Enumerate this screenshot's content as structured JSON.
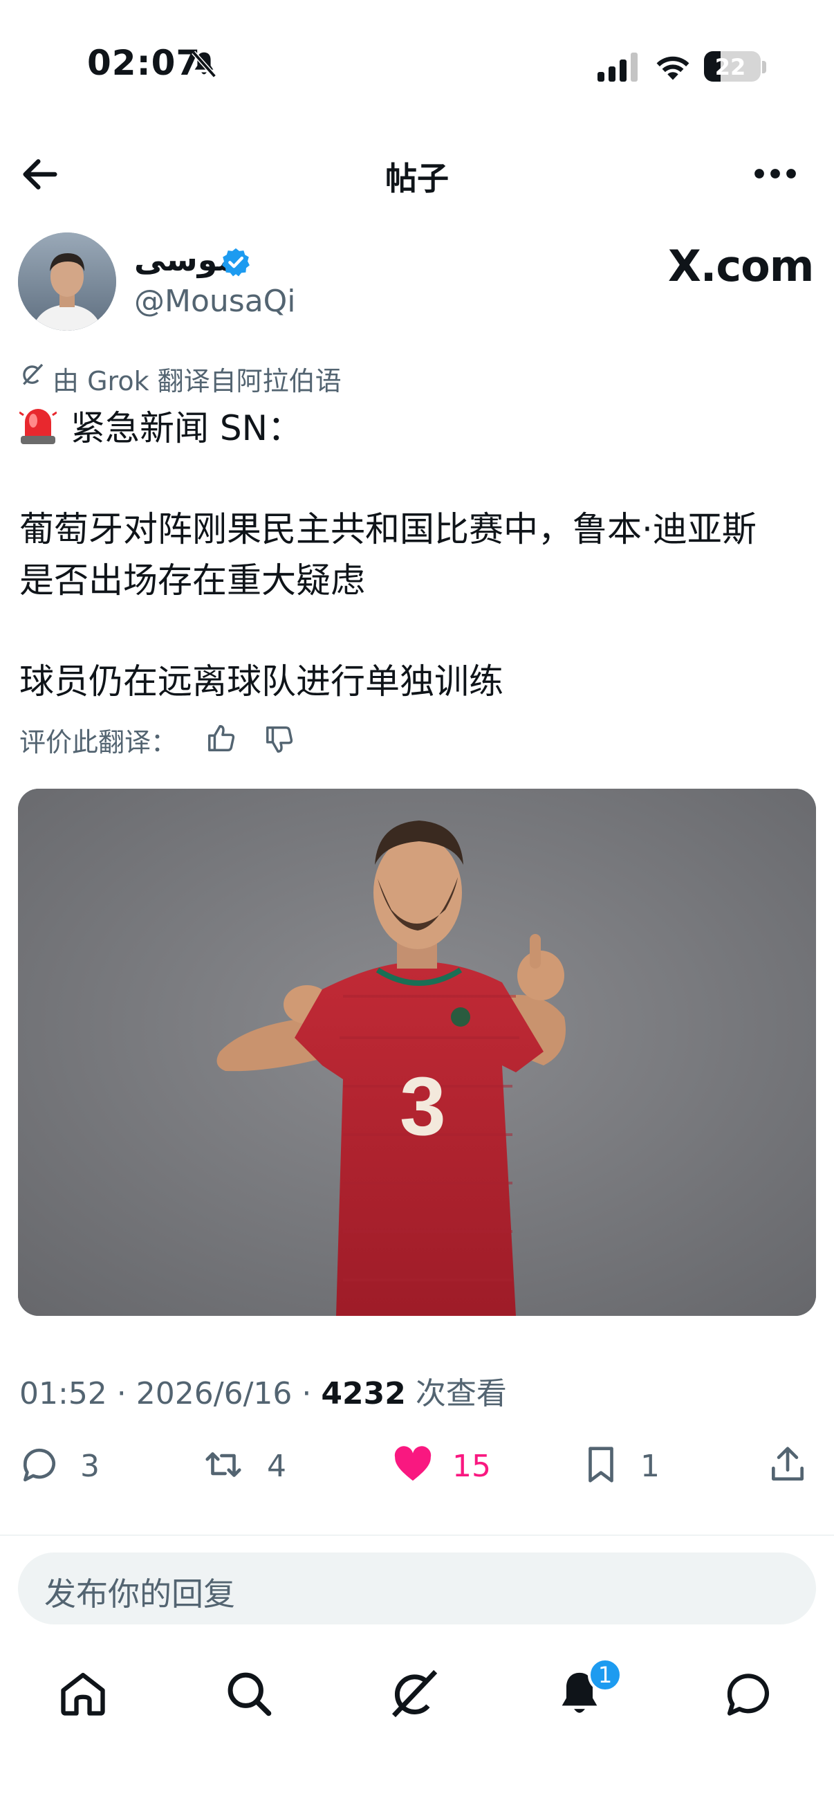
{
  "status_bar": {
    "time": "02:07",
    "battery": "22",
    "icons": [
      "bell-slash-icon",
      "cellular-signal-icon",
      "wifi-icon",
      "battery-icon"
    ]
  },
  "header": {
    "title": "帖子",
    "back_icon": "arrow-left-icon",
    "more_icon": "ellipsis-icon"
  },
  "author": {
    "name": "موسى",
    "handle": "@MousaQi",
    "verified": true,
    "source_badge": "X.com"
  },
  "translation_note": "由 Grok 翻译自阿拉伯语",
  "post": {
    "line1": "紧急新闻 SN：",
    "line2a": "葡萄牙对阵刚果民主共和国比赛中，鲁本·迪亚斯",
    "line2b": "是否出场存在重大疑虑",
    "line3": "球员仍在远离球队进行单独训练"
  },
  "rate_translation": {
    "label": "评价此翻译：",
    "icons": [
      "thumbs-up-icon",
      "thumbs-down-icon"
    ]
  },
  "meta": {
    "time": "01:52",
    "date": "2026/6/16",
    "views": "4232",
    "views_label": "次查看",
    "sep": " · "
  },
  "actions": {
    "replies": "3",
    "reposts": "4",
    "likes": "15",
    "bookmarks": "1"
  },
  "reply_placeholder": "发布你的回复",
  "tab_bar": {
    "items": [
      "home-icon",
      "search-icon",
      "grok-icon",
      "notifications-icon",
      "messages-icon"
    ],
    "notification_badge": "1"
  },
  "colors": {
    "text": "#0f1419",
    "secondary": "#536471",
    "accent": "#1d9bf0",
    "like": "#f91880",
    "jersey": "#b3212e"
  }
}
